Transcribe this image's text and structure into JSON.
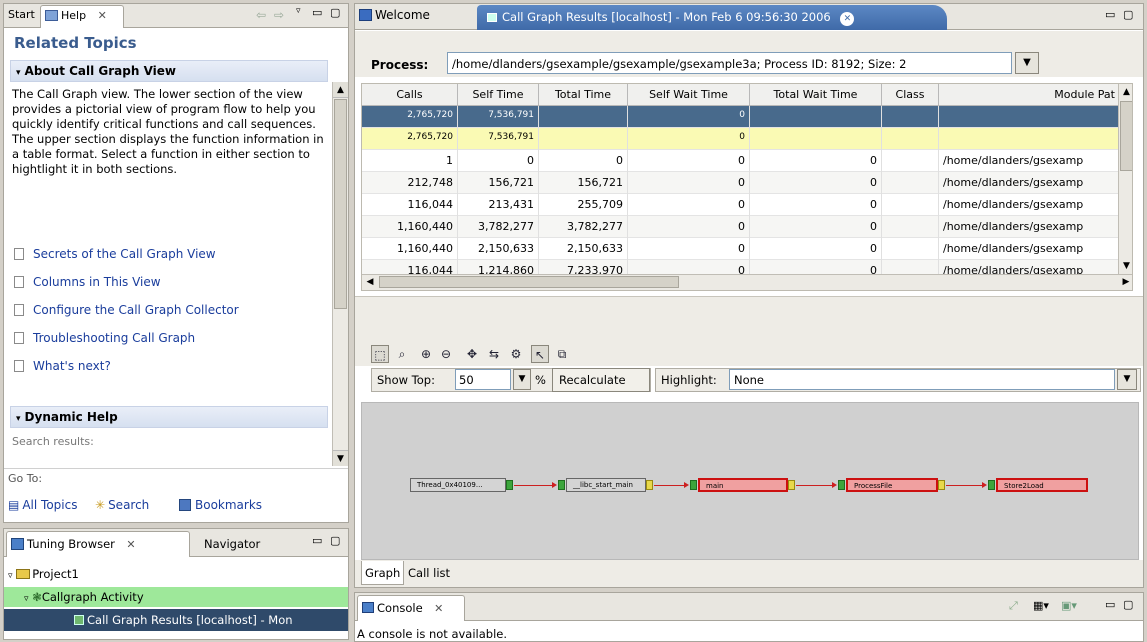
{
  "left_top": {
    "tabs": [
      "Start",
      "Help"
    ],
    "related_topics": "Related Topics",
    "about_header": "About Call Graph View",
    "about_text": "The Call Graph view. The lower section of the view provides a pictorial view of program flow to help you quickly identify critical functions and call sequences. The upper section displays the function information in a table format. Select a function in either section to hightlight it in both sections.",
    "links": [
      "Secrets of the Call Graph View",
      "Columns in This View",
      "Configure the Call Graph Collector",
      "Troubleshooting Call Graph",
      "What's next?"
    ],
    "dynamic_help": "Dynamic Help",
    "search_results": "Search results:",
    "go_to": "Go To:",
    "all_topics": "All Topics",
    "search": "Search",
    "bookmarks": "Bookmarks"
  },
  "left_bottom": {
    "tabs": [
      "Tuning Browser",
      "Navigator"
    ],
    "tree": [
      "Project1",
      "Callgraph Activity",
      "Call Graph Results [localhost] - Mon"
    ]
  },
  "editor": {
    "tabs": [
      "Welcome",
      "Call Graph Results [localhost] - Mon Feb  6 09:56:30 2006"
    ],
    "process_label": "Process:",
    "process_value": "/home/dlanders/gsexample/gsexample/gsexample3a; Process ID: 8192; Size: 2",
    "columns": [
      "Calls",
      "Self Time",
      "Total Time",
      "Self Wait Time",
      "Total Wait Time",
      "Class",
      "Module Pat"
    ],
    "rows": [
      [
        "2,765,720",
        "7,536,791",
        "",
        "0",
        "",
        "",
        ""
      ],
      [
        "2,765,720",
        "7,536,791",
        "",
        "0",
        "",
        "",
        ""
      ],
      [
        "1",
        "0",
        "0",
        "0",
        "0",
        "",
        "/home/dlanders/gsexamp"
      ],
      [
        "212,748",
        "156,721",
        "156,721",
        "0",
        "0",
        "",
        "/home/dlanders/gsexamp"
      ],
      [
        "116,044",
        "213,431",
        "255,709",
        "0",
        "0",
        "",
        "/home/dlanders/gsexamp"
      ],
      [
        "1,160,440",
        "3,782,277",
        "3,782,277",
        "0",
        "0",
        "",
        "/home/dlanders/gsexamp"
      ],
      [
        "1,160,440",
        "2,150,633",
        "2,150,633",
        "0",
        "0",
        "",
        "/home/dlanders/gsexamp"
      ],
      [
        "116,044",
        "1,214,860",
        "7,233,970",
        "0",
        "0",
        "",
        "/home/dlanders/gsexamp"
      ]
    ],
    "show_top_label": "Show Top:",
    "show_top_value": "50",
    "percent": "%",
    "recalculate": "Recalculate",
    "highlight_label": "Highlight:",
    "highlight_value": "None",
    "graph_nodes": [
      "Thread_0x40109...",
      "__libc_start_main",
      "main",
      "ProcessFile",
      "Store2Load"
    ],
    "bottom_tabs": [
      "Graph",
      "Call list"
    ]
  },
  "console": {
    "tab": "Console",
    "message": "A console is not available."
  },
  "colors": {
    "selected_row": "#486a8c",
    "highlight_row": "#fafab4",
    "tree_selected": "#9ee89a",
    "tree_active": "#2f4a6a"
  }
}
